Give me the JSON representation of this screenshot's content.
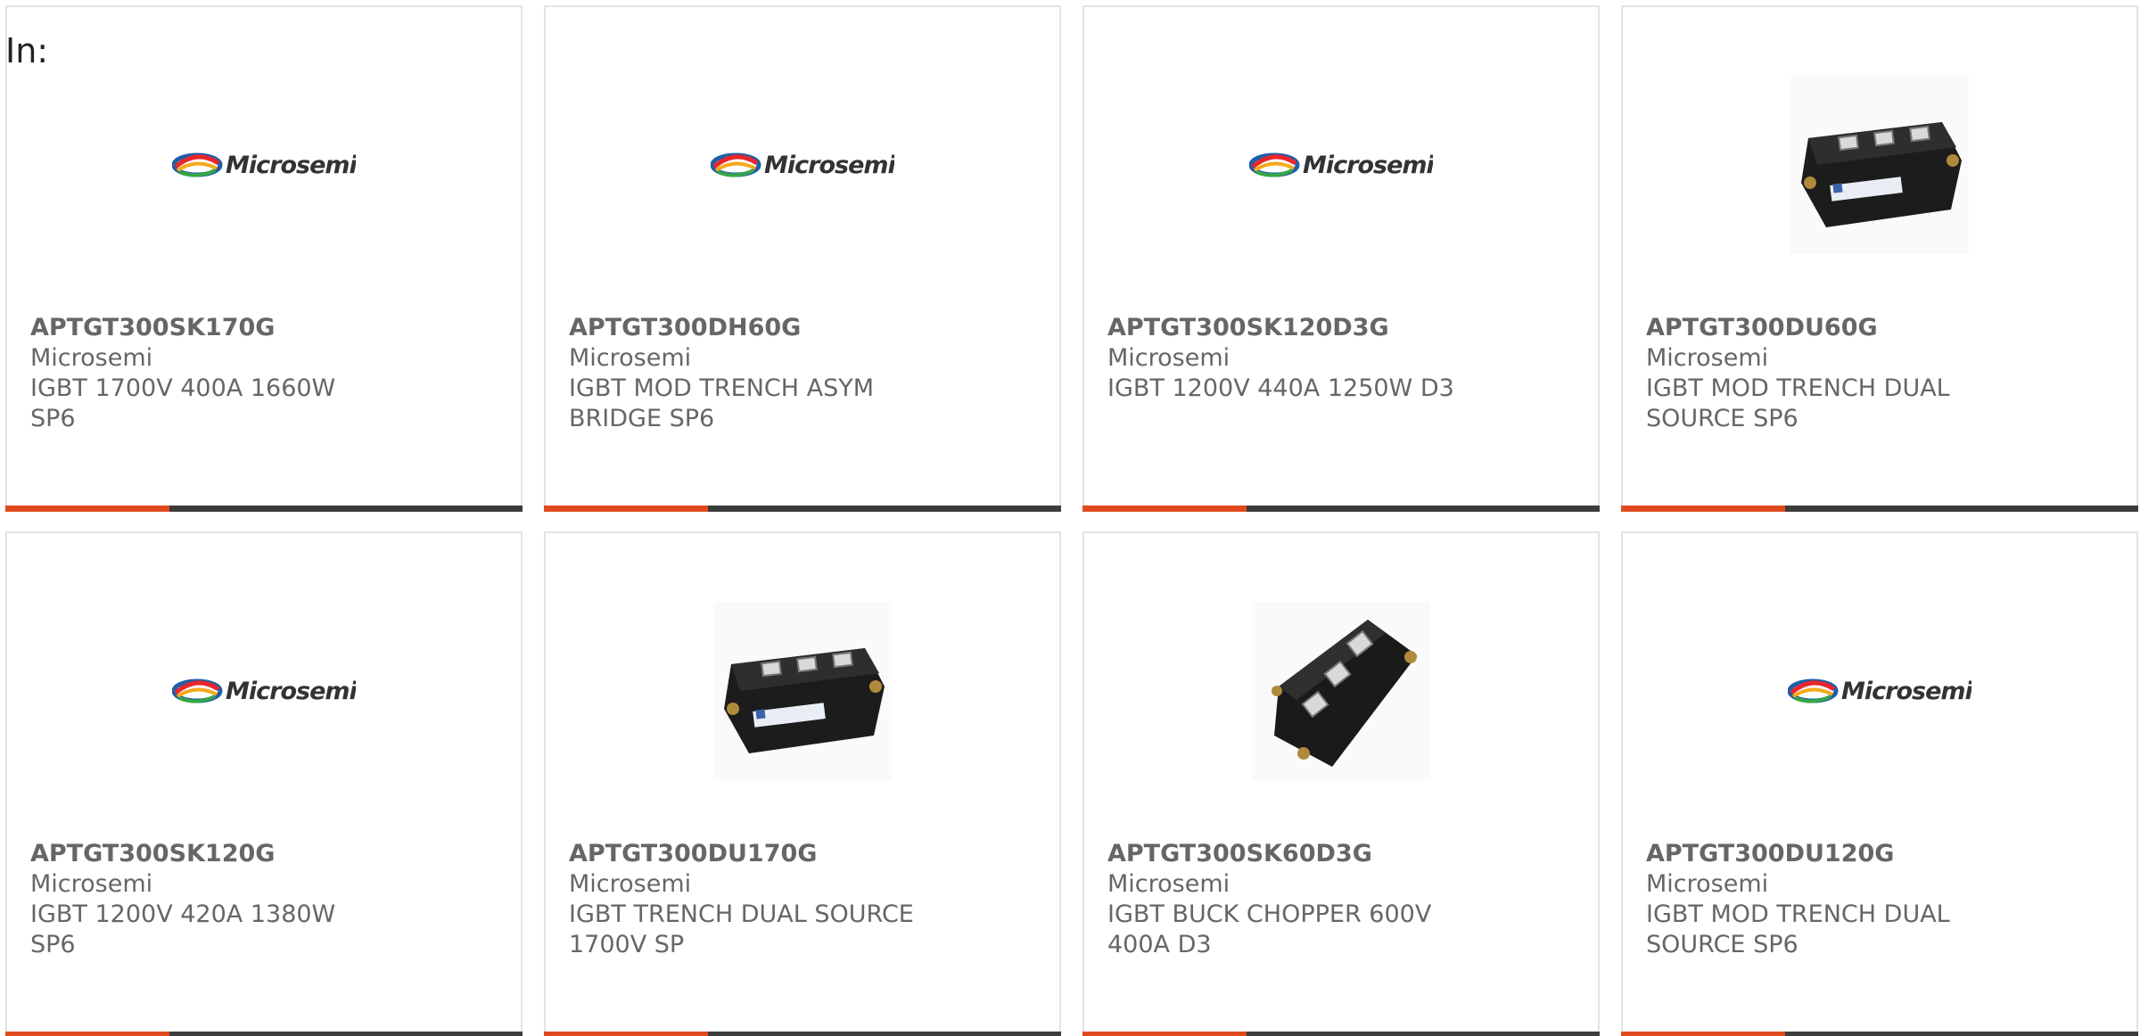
{
  "header": {
    "in_label": "In:"
  },
  "colors": {
    "accent": "#e04a1c",
    "bar_dark": "#3c3c3c",
    "text": "#666666",
    "border": "#e3e3e3"
  },
  "logo": {
    "text": "Microsemi",
    "icon": "microsemi-logo"
  },
  "products": [
    {
      "part_number": "APTGT300SK170G",
      "manufacturer": "Microsemi",
      "description": "IGBT 1700V 400A 1660W SP6",
      "image": "microsemi-logo"
    },
    {
      "part_number": "APTGT300DH60G",
      "manufacturer": "Microsemi",
      "description": "IGBT MOD TRENCH ASYM BRIDGE SP6",
      "image": "microsemi-logo"
    },
    {
      "part_number": "APTGT300SK120D3G",
      "manufacturer": "Microsemi",
      "description": "IGBT 1200V 440A 1250W D3",
      "image": "microsemi-logo"
    },
    {
      "part_number": "APTGT300DU60G",
      "manufacturer": "Microsemi",
      "description": "IGBT MOD TRENCH DUAL SOURCE SP6",
      "image": "igbt-module-photo"
    },
    {
      "part_number": "APTGT300SK120G",
      "manufacturer": "Microsemi",
      "description": "IGBT 1200V 420A 1380W SP6",
      "image": "microsemi-logo"
    },
    {
      "part_number": "APTGT300DU170G",
      "manufacturer": "Microsemi",
      "description": "IGBT TRENCH DUAL SOURCE 1700V SP",
      "image": "igbt-module-photo"
    },
    {
      "part_number": "APTGT300SK60D3G",
      "manufacturer": "Microsemi",
      "description": "IGBT BUCK CHOPPER 600V 400A D3",
      "image": "igbt-module-photo-angled"
    },
    {
      "part_number": "APTGT300DU120G",
      "manufacturer": "Microsemi",
      "description": "IGBT MOD TRENCH DUAL SOURCE SP6",
      "image": "microsemi-logo"
    }
  ]
}
